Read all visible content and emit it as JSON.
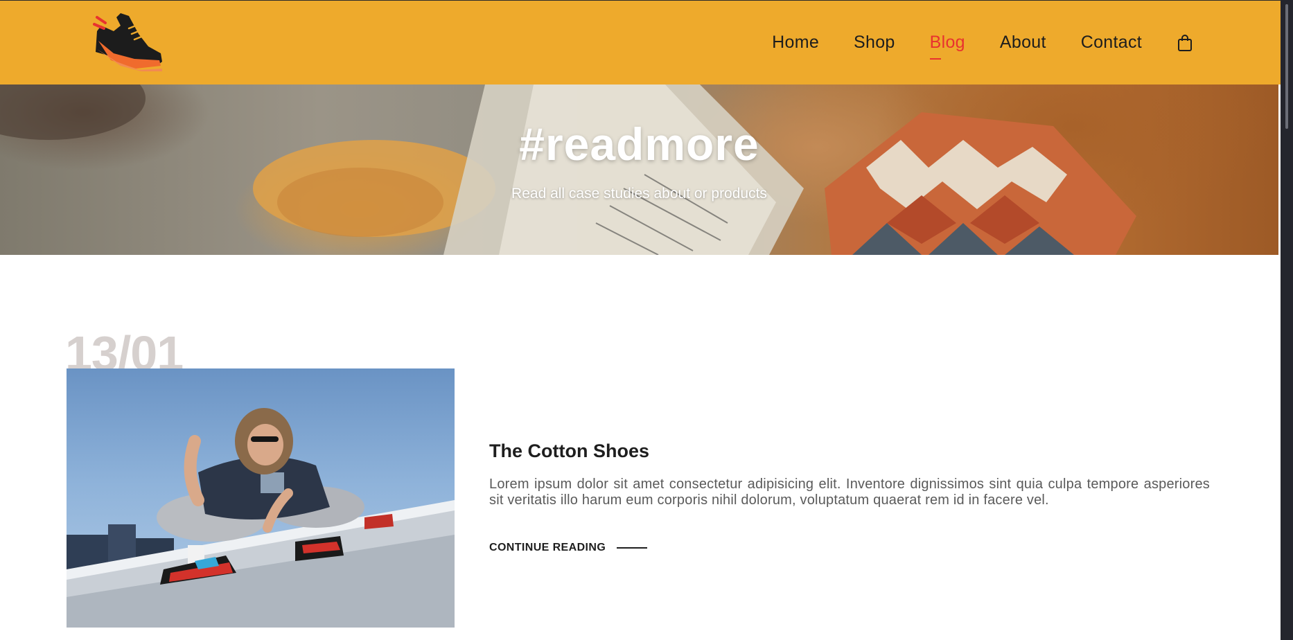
{
  "nav": {
    "items": [
      {
        "label": "Home",
        "active": false
      },
      {
        "label": "Shop",
        "active": false
      },
      {
        "label": "Blog",
        "active": true
      },
      {
        "label": "About",
        "active": false
      },
      {
        "label": "Contact",
        "active": false
      }
    ],
    "cart_icon": "shopping-bag-icon",
    "logo_icon": "sneaker-logo-icon"
  },
  "hero": {
    "title": "#readmore",
    "subtitle": "Read all case studies about or products"
  },
  "post": {
    "date": "13/01",
    "title": "The Cotton Shoes",
    "excerpt": "Lorem ipsum dolor sit amet consectetur adipisicing elit. Inventore dignissimos sint quia culpa tempore asperiores sit veritatis illo harum eum corporis nihil dolorum, voluptatum quaerat rem id in facere vel.",
    "cta": "CONTINUE READING"
  },
  "colors": {
    "header_bg": "#eeaa2c",
    "accent": "#e8322f",
    "date_color": "#d6d0ce"
  }
}
